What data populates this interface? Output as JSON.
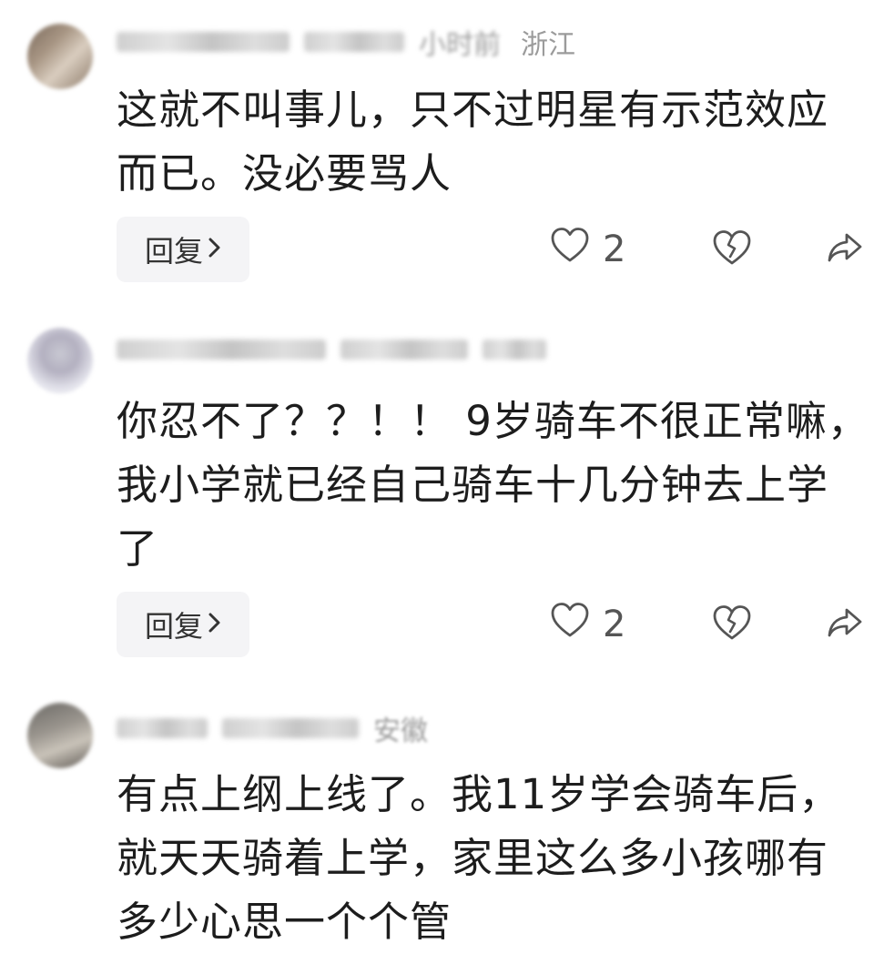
{
  "comments": [
    {
      "meta_time": "小时前",
      "meta_location": "浙江",
      "text_lines": [
        "这就不叫事儿，只不过明星有示范效应",
        "而已。没必要骂人"
      ],
      "reply_label": "回复",
      "likes": "2"
    },
    {
      "meta_time": "",
      "meta_location": "",
      "text_lines": [
        "你忍不了？？！！ 9岁骑车不很正常嘛，",
        "我小学就已经自己骑车十几分钟去上学",
        "了"
      ],
      "reply_label": "回复",
      "likes": "2"
    },
    {
      "meta_time": "",
      "meta_location": "安徽",
      "text_lines": [
        "有点上纲上线了。我11岁学会骑车后，",
        "就天天骑着上学，家里这么多小孩哪有",
        "多少心思一个个管"
      ]
    }
  ],
  "icons": {
    "reply_chevron": "chevron-right-icon",
    "like": "heart-icon",
    "dislike": "broken-heart-icon",
    "share": "share-arrow-icon"
  }
}
